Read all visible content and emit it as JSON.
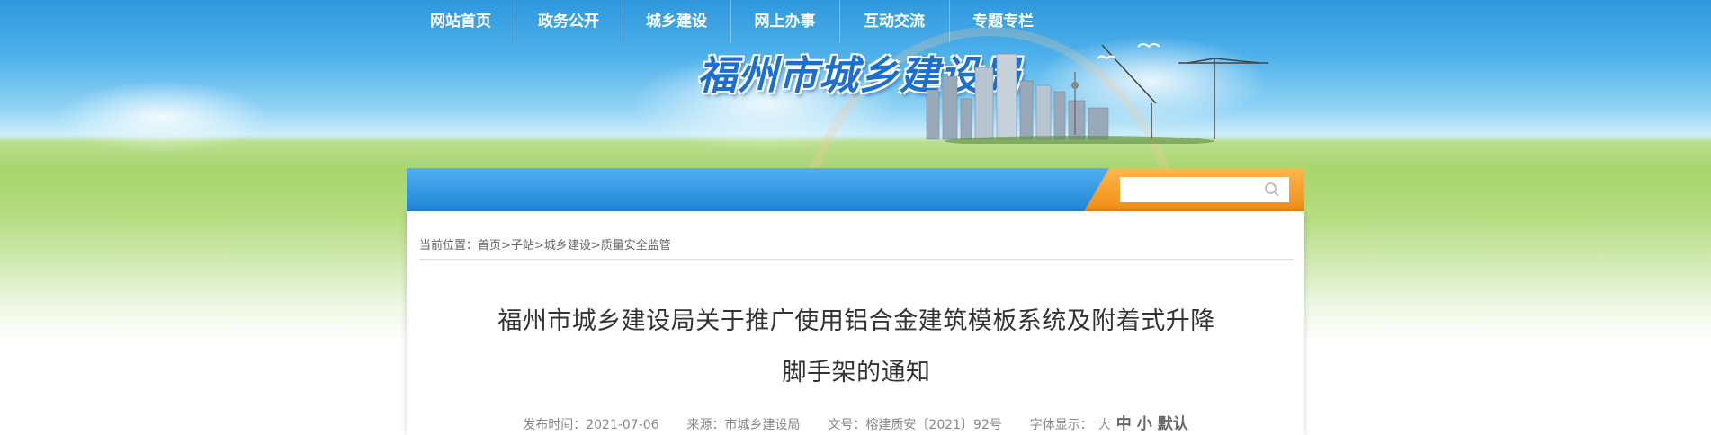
{
  "header": {
    "site_title": "福州市城乡建设局"
  },
  "nav": {
    "items": [
      {
        "label": "网站首页"
      },
      {
        "label": "政务公开"
      },
      {
        "label": "城乡建设"
      },
      {
        "label": "网上办事"
      },
      {
        "label": "互动交流"
      },
      {
        "label": "专题专栏"
      }
    ],
    "search": {
      "placeholder": ""
    }
  },
  "breadcrumb": {
    "prefix": "当前位置：",
    "items": [
      "首页",
      "子站",
      "城乡建设",
      "质量安全监管"
    ],
    "separator": ">"
  },
  "article": {
    "title_line1": "福州市城乡建设局关于推广使用铝合金建筑模板系统及附着式升降",
    "title_line2": "脚手架的通知",
    "publish_label": "发布时间：",
    "publish_date": "2021-07-06",
    "source_label": "来源：",
    "source": "市城乡建设局",
    "docno_label": "文号：",
    "docno": "榕建质安〔2021〕92号",
    "fontsize_label": "字体显示：",
    "fontsize_options": [
      "大",
      "中",
      "小",
      "默认"
    ]
  },
  "colors": {
    "nav_blue": "#1f84d8",
    "search_orange": "#f08c14",
    "logo_blue": "#1b6fd0"
  }
}
